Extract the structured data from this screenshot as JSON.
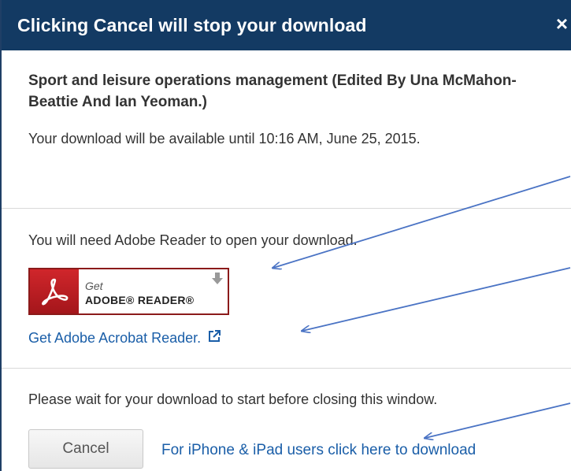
{
  "dialog": {
    "title": "Clicking Cancel will stop your download",
    "close_glyph": "×",
    "close_icon": "close-icon"
  },
  "download_info": {
    "document_title": "Sport and leisure operations management (Edited By Una McMahon-Beattie And Ian Yeoman.)",
    "availability": "Your download will be available until 10:16 AM, June 25, 2015."
  },
  "reader_section": {
    "need_reader_text": "You will need Adobe Reader to open your download.",
    "badge": {
      "get_label": "Get",
      "brand_label": "ADOBE® READER®",
      "logo_icon": "adobe-acrobat-logo-icon",
      "arrow_icon": "download-arrow-icon"
    },
    "acrobat_link_text": "Get Adobe Acrobat Reader.",
    "external_icon": "external-link-icon"
  },
  "footer": {
    "wait_text": "Please wait for your download to start before closing this window.",
    "cancel_label": "Cancel",
    "iphone_link_text": "For iPhone & iPad users click here to download"
  },
  "colors": {
    "title_bar": "#133a63",
    "link": "#1a5ea8",
    "annotation_arrow": "#4a73c4",
    "adobe_red": "#c1202a"
  }
}
